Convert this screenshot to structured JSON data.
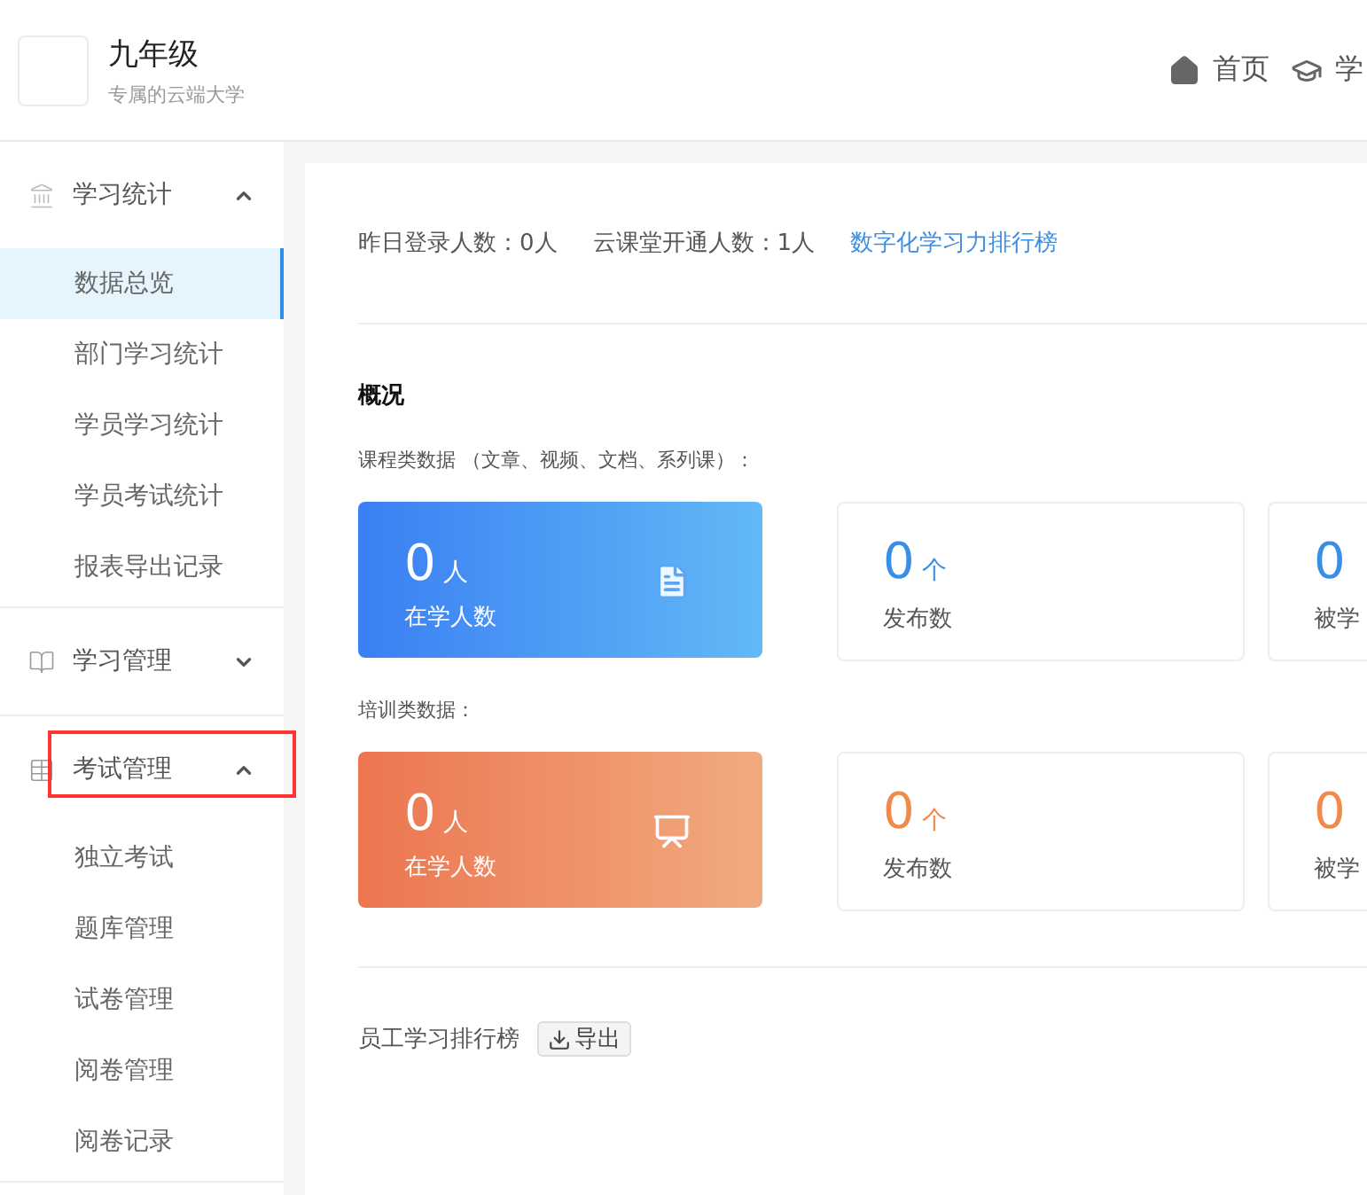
{
  "brand": {
    "title": "九年级",
    "subtitle": "专属的云端大学"
  },
  "top_nav": [
    {
      "label": "首页",
      "kind": "home"
    },
    {
      "label": "学",
      "kind": "school"
    }
  ],
  "sidebar": {
    "groups": [
      {
        "label": "学习统计",
        "kind": "stats",
        "expanded": true,
        "highlighted": false,
        "children": [
          {
            "label": "数据总览",
            "selected": true
          },
          {
            "label": "部门学习统计",
            "selected": false
          },
          {
            "label": "学员学习统计",
            "selected": false
          },
          {
            "label": "学员考试统计",
            "selected": false
          },
          {
            "label": "报表导出记录",
            "selected": false
          }
        ]
      },
      {
        "label": "学习管理",
        "kind": "study",
        "expanded": false,
        "highlighted": false
      },
      {
        "label": "考试管理",
        "kind": "exam",
        "expanded": true,
        "highlighted": true,
        "children": [
          {
            "label": "独立考试",
            "selected": false
          },
          {
            "label": "题库管理",
            "selected": false
          },
          {
            "label": "试卷管理",
            "selected": false
          },
          {
            "label": "阅卷管理",
            "selected": false
          },
          {
            "label": "阅卷记录",
            "selected": false
          }
        ]
      }
    ]
  },
  "summary": {
    "stats": [
      "昨日登录人数：0人",
      "云课堂开通人数：1人"
    ],
    "link": "数字化学习力排行榜"
  },
  "overview": {
    "title": "概况",
    "sections": [
      {
        "label": "课程类数据 （文章、视频、文档、系列课）：",
        "kind": "course",
        "feature": {
          "value": "0",
          "unit": "人",
          "label": "在学人数"
        },
        "stats": [
          {
            "value": "0",
            "unit": "个",
            "label": "发布数"
          },
          {
            "value": "0",
            "label": "被学"
          }
        ]
      },
      {
        "label": "培训类数据：",
        "kind": "training",
        "feature": {
          "value": "0",
          "unit": "人",
          "label": "在学人数"
        },
        "stats": [
          {
            "value": "0",
            "unit": "个",
            "label": "发布数"
          },
          {
            "value": "0",
            "label": "被学"
          }
        ]
      }
    ]
  },
  "ranking": {
    "title": "员工学习排行榜",
    "export_button": "导出"
  }
}
